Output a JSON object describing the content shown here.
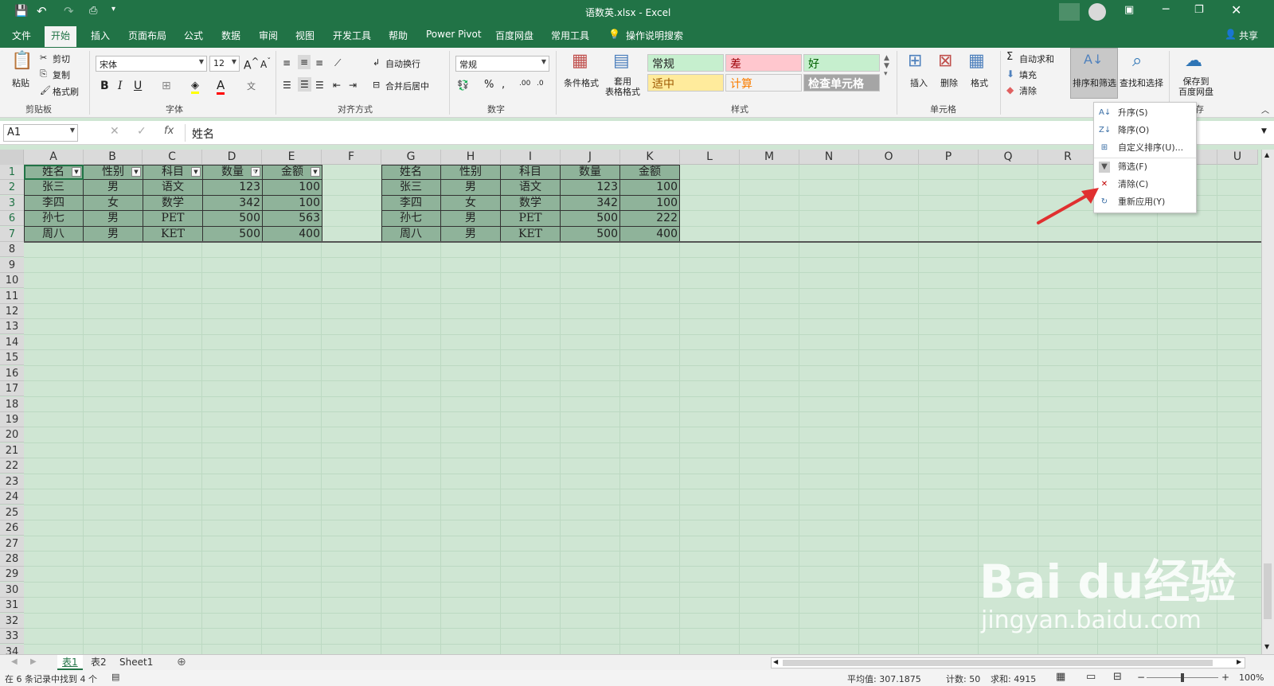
{
  "window": {
    "title": "语数英.xlsx - Excel"
  },
  "qat": {
    "save": "保存",
    "undo": "撤消",
    "redo": "恢复",
    "preview": "打印预览"
  },
  "tabs": [
    "文件",
    "开始",
    "插入",
    "页面布局",
    "公式",
    "数据",
    "审阅",
    "视图",
    "开发工具",
    "帮助",
    "Power Pivot",
    "百度网盘",
    "常用工具"
  ],
  "tellme": "操作说明搜索",
  "share": "共享",
  "ribbon": {
    "clipboard": {
      "paste": "粘贴",
      "cut": "剪切",
      "copy": "复制",
      "format_painter": "格式刷",
      "label": "剪贴板"
    },
    "font": {
      "name": "宋体",
      "size": "12",
      "label": "字体"
    },
    "alignment": {
      "wrap": "自动换行",
      "merge": "合并后居中",
      "label": "对齐方式"
    },
    "number": {
      "format": "常规",
      "label": "数字"
    },
    "styles": {
      "cond": "条件格式",
      "table": "套用\n表格格式",
      "label": "样式",
      "items": [
        {
          "text": "常规",
          "bg": "#c6efce",
          "fg": "#222222"
        },
        {
          "text": "差",
          "bg": "#ffc7ce",
          "fg": "#9c0006"
        },
        {
          "text": "好",
          "bg": "#c6efce",
          "fg": "#006100"
        },
        {
          "text": "适中",
          "bg": "#ffeb9c",
          "fg": "#9c5700"
        },
        {
          "text": "计算",
          "bg": "#f2f2f2",
          "fg": "#fa7d00"
        },
        {
          "text": "检查单元格",
          "bg": "#a5a5a5",
          "fg": "#ffffff"
        }
      ]
    },
    "cells": {
      "insert": "插入",
      "delete": "删除",
      "format": "格式",
      "label": "单元格"
    },
    "editing": {
      "autosum": "自动求和",
      "fill": "填充",
      "clear": "清除",
      "sort_filter": "排序和筛选",
      "find": "查找和选择"
    },
    "save_group": {
      "btn": "保存到\n百度网盘",
      "label": "保存"
    }
  },
  "formula_bar": {
    "name_box": "A1",
    "value": "姓名",
    "fx": "fx"
  },
  "columns": [
    "A",
    "B",
    "C",
    "D",
    "E",
    "F",
    "G",
    "H",
    "I",
    "J",
    "K",
    "L",
    "M",
    "N",
    "O",
    "P",
    "Q",
    "R",
    "S",
    "T",
    "U"
  ],
  "rows": [
    "1",
    "2",
    "3",
    "6",
    "7",
    "8",
    "9",
    "10",
    "11",
    "12",
    "13",
    "14",
    "15",
    "16",
    "17",
    "18",
    "19",
    "20",
    "21",
    "22",
    "23",
    "24",
    "25",
    "26",
    "27",
    "28",
    "29",
    "30",
    "31",
    "32",
    "33",
    "34"
  ],
  "table1": {
    "headers": [
      "姓名",
      "性别",
      "科目",
      "数量",
      "金额"
    ],
    "rows": [
      [
        "张三",
        "男",
        "语文",
        "123",
        "100"
      ],
      [
        "李四",
        "女",
        "数学",
        "342",
        "100"
      ],
      [
        "孙七",
        "男",
        "PET",
        "500",
        "563"
      ],
      [
        "周八",
        "男",
        "KET",
        "500",
        "400"
      ]
    ]
  },
  "table2": {
    "headers": [
      "姓名",
      "性别",
      "科目",
      "数量",
      "金额"
    ],
    "rows": [
      [
        "张三",
        "男",
        "语文",
        "123",
        "100"
      ],
      [
        "李四",
        "女",
        "数学",
        "342",
        "100"
      ],
      [
        "孙七",
        "男",
        "PET",
        "500",
        "222"
      ],
      [
        "周八",
        "男",
        "KET",
        "500",
        "400"
      ]
    ]
  },
  "menu": [
    "升序(S)",
    "降序(O)",
    "自定义排序(U)...",
    "筛选(F)",
    "清除(C)",
    "重新应用(Y)"
  ],
  "sheets": [
    "表1",
    "表2",
    "Sheet1"
  ],
  "status": {
    "left": "在 6 条记录中找到 4 个",
    "avg": "平均值: 307.1875",
    "count": "计数: 50",
    "sum": "求和: 4915",
    "zoom": "100%"
  },
  "watermark": {
    "brand": "Bai  du经验",
    "url": "jingyan.baidu.com"
  },
  "colors": {
    "excel_green": "#217346",
    "sheet_bg": "#cfe6d3",
    "table_bg": "#8fb39a"
  }
}
